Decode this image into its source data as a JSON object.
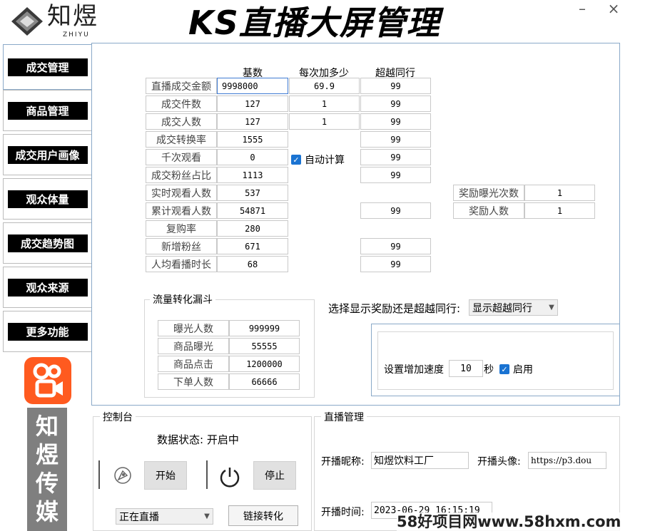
{
  "header": {
    "logo_text": "知煜",
    "logo_sub": "ZHIYU",
    "title": "KS直播大屏管理",
    "minimize": "–",
    "close": "×"
  },
  "sidebar": {
    "tabs": [
      {
        "label": "成交管理"
      },
      {
        "label": "商品管理"
      },
      {
        "label": "成交用户画像"
      },
      {
        "label": "观众体量"
      },
      {
        "label": "成交趋势图"
      },
      {
        "label": "观众来源"
      },
      {
        "label": "更多功能"
      }
    ],
    "brand_vertical": "知煜传媒"
  },
  "main": {
    "columns": {
      "base": "基数",
      "increment": "每次加多少",
      "surpass": "超越同行"
    },
    "rows": [
      {
        "label": "直播成交金额",
        "base": "9998000",
        "increment": "69.9",
        "surpass": "99"
      },
      {
        "label": "成交件数",
        "base": "127",
        "increment": "1",
        "surpass": "99"
      },
      {
        "label": "成交人数",
        "base": "127",
        "increment": "1",
        "surpass": "99"
      },
      {
        "label": "成交转换率",
        "base": "1555",
        "surpass": "99"
      },
      {
        "label": "千次观看",
        "base": "0",
        "surpass": "99"
      },
      {
        "label": "成交粉丝占比",
        "base": "1113",
        "surpass": "99"
      },
      {
        "label": "实时观看人数",
        "base": "537"
      },
      {
        "label": "累计观看人数",
        "base": "54871",
        "surpass": "99"
      },
      {
        "label": "复购率",
        "base": "280"
      },
      {
        "label": "新增粉丝",
        "base": "671",
        "surpass": "99"
      },
      {
        "label": "人均看播时长",
        "base": "68",
        "surpass": "99"
      }
    ],
    "auto_calc_label": "自动计算",
    "reward": [
      {
        "label": "奖励曝光次数",
        "value": "1"
      },
      {
        "label": "奖励人数",
        "value": "1"
      }
    ],
    "funnel": {
      "title": "流量转化漏斗",
      "rows": [
        {
          "label": "曝光人数",
          "value": "999999"
        },
        {
          "label": "商品曝光",
          "value": "55555"
        },
        {
          "label": "商品点击",
          "value": "1200000"
        },
        {
          "label": "下单人数",
          "value": "66666"
        }
      ]
    },
    "display_select": {
      "label": "选择显示奖励还是超越同行:",
      "value": "显示超越同行"
    },
    "speed": {
      "label": "设置增加速度",
      "value": "10",
      "unit": "秒",
      "enable_label": "启用"
    }
  },
  "console": {
    "title": "控制台",
    "status_label": "数据状态:",
    "status_value": "开启中",
    "start_label": "开始",
    "stop_label": "停止",
    "mode_value": "正在直播",
    "link_label": "链接转化"
  },
  "live": {
    "title": "直播管理",
    "nickname_label": "开播昵称:",
    "nickname_value": "知煜饮料工厂",
    "avatar_label": "开播头像:",
    "avatar_value": "https://p3.dou",
    "time_label": "开播时间:",
    "time_value": "2023-06-29 16:15:19"
  },
  "watermark": "58好项目网www.58hxm.com",
  "colors": {
    "accent": "#1a73d2",
    "kuaishou": "#ff5a1f",
    "brand_panel": "#7f7f7f"
  }
}
